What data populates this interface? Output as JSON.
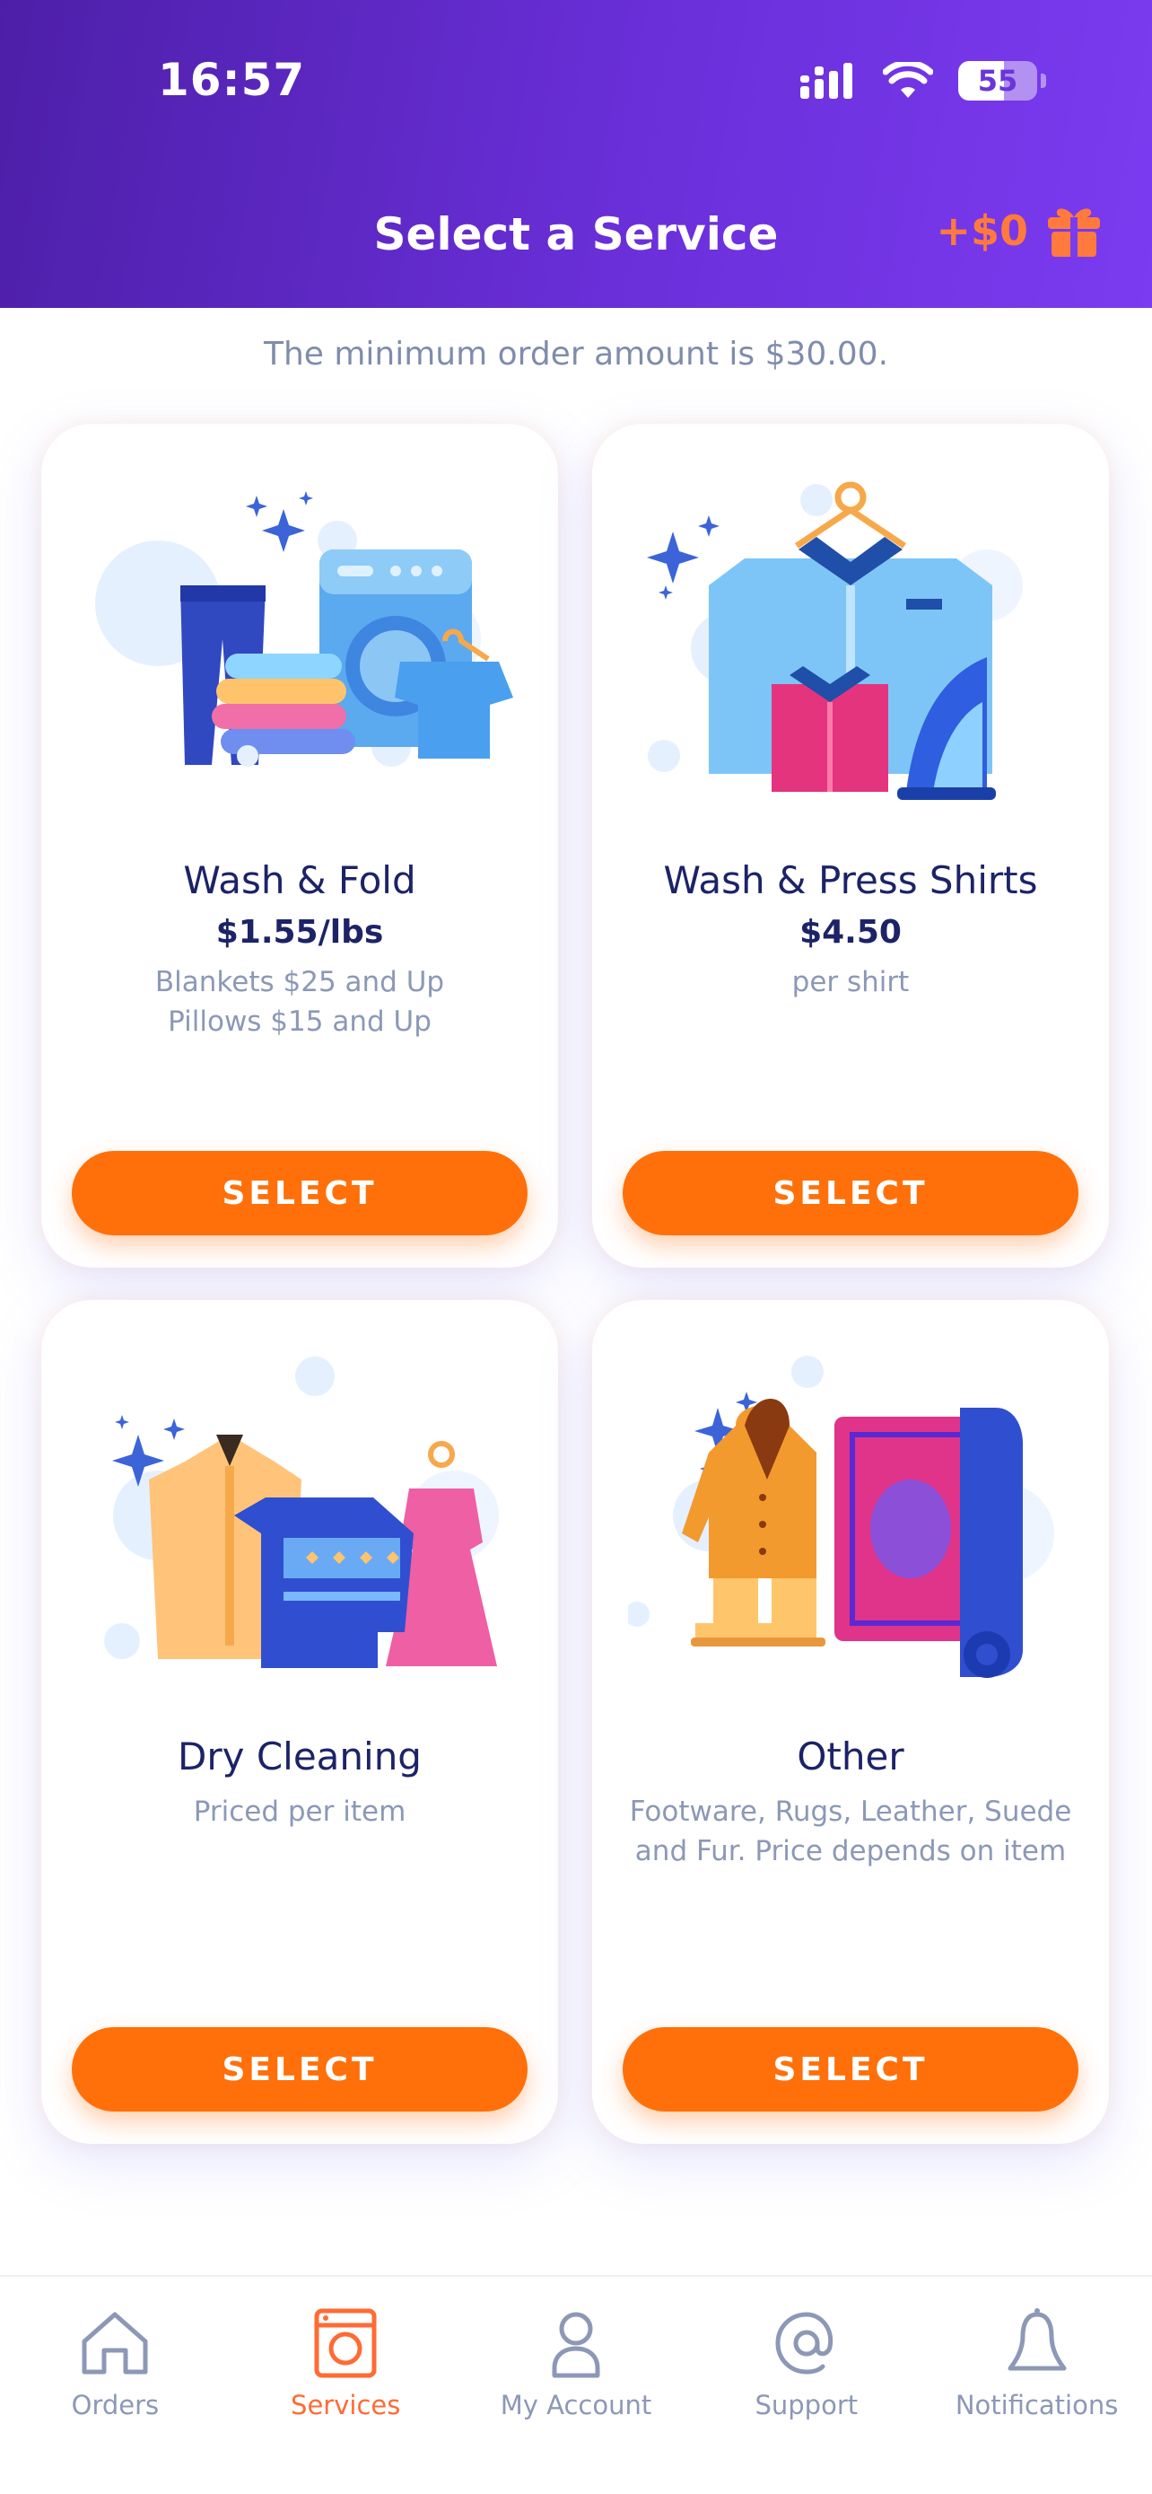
{
  "status_bar": {
    "time": "16:57",
    "battery": "55"
  },
  "header": {
    "title": "Select a Service",
    "credit": "+$0"
  },
  "min_order_text": "The minimum order amount is $30.00.",
  "services": [
    {
      "name": "Wash & Fold",
      "price": "$1.55/lbs",
      "desc_lines": [
        "Blankets $25 and Up",
        "Pillows $15 and Up"
      ],
      "button": "SELECT"
    },
    {
      "name": "Wash & Press Shirts",
      "price": "$4.50",
      "desc_lines": [
        "per shirt"
      ],
      "button": "SELECT"
    },
    {
      "name": "Dry Cleaning",
      "price": "",
      "desc_lines": [
        "Priced per item"
      ],
      "button": "SELECT"
    },
    {
      "name": "Other",
      "price": "",
      "desc_lines": [
        "Footware, Rugs, Leather, Suede",
        "and Fur. Price depends on item"
      ],
      "button": "SELECT"
    }
  ],
  "nav": [
    {
      "label": "Orders",
      "icon": "home-icon",
      "active": false
    },
    {
      "label": "Services",
      "icon": "washing-machine-icon",
      "active": true
    },
    {
      "label": "My Account",
      "icon": "user-icon",
      "active": false
    },
    {
      "label": "Support",
      "icon": "at-sign-icon",
      "active": false
    },
    {
      "label": "Notifications",
      "icon": "bell-icon",
      "active": false
    }
  ],
  "colors": {
    "header_start": "#4d1fa8",
    "header_end": "#7b3bf0",
    "accent": "#ff700a",
    "title_text": "#1c2367",
    "muted_text": "#8c98b6"
  }
}
